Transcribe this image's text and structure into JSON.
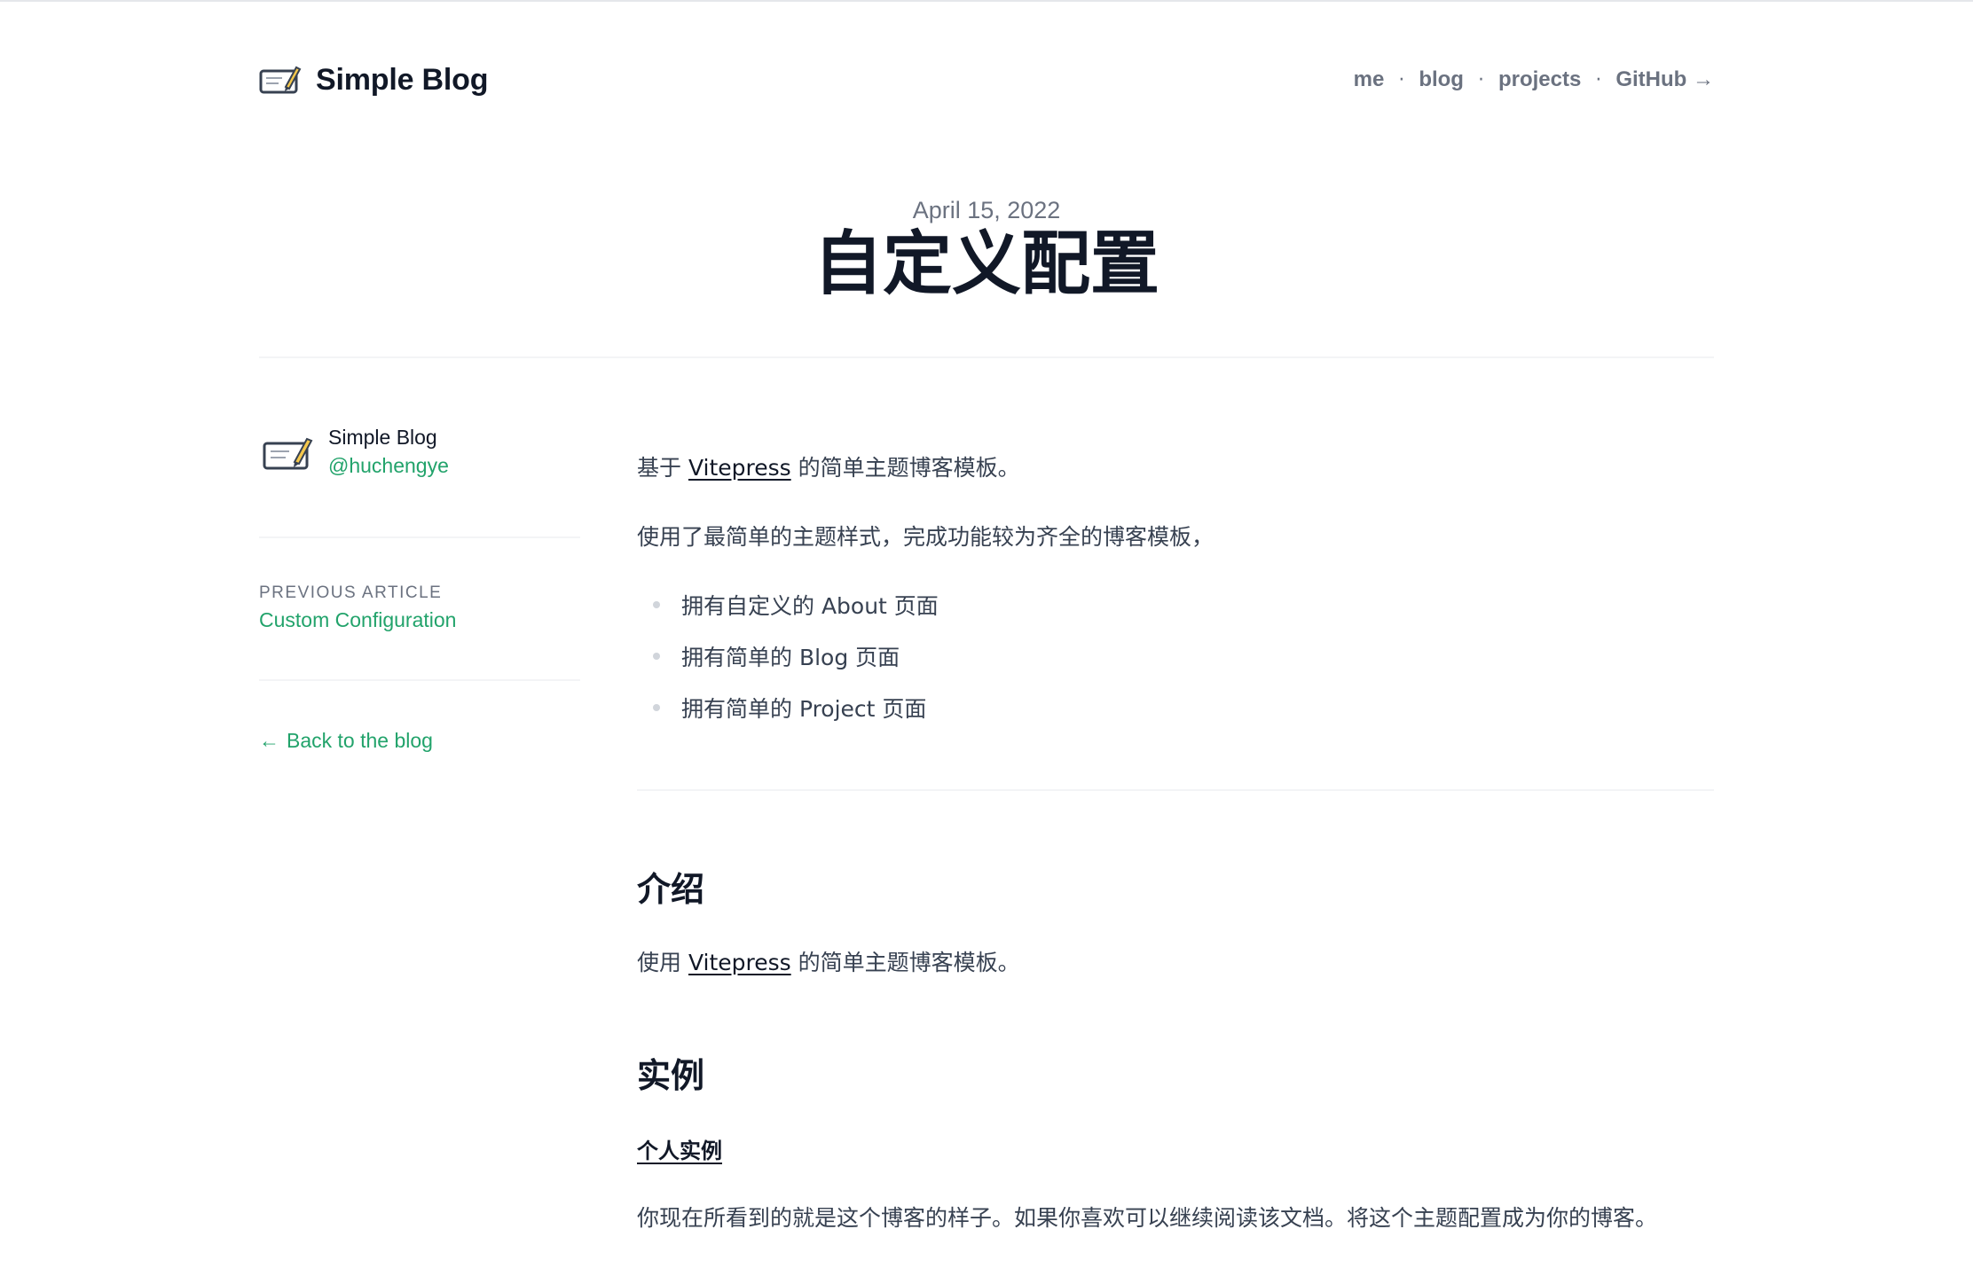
{
  "header": {
    "brand": "Simple Blog",
    "nav": [
      {
        "label": "me"
      },
      {
        "label": "blog"
      },
      {
        "label": "projects"
      },
      {
        "label": "GitHub →"
      }
    ],
    "separator": "·"
  },
  "post": {
    "date": "April 15, 2022",
    "title": "自定义配置"
  },
  "sidebar": {
    "author_name": "Simple Blog",
    "author_handle": "@huchengye",
    "prev_label": "PREVIOUS ARTICLE",
    "prev_title": "Custom Configuration",
    "back_arrow": "←",
    "back_label": "Back to the blog"
  },
  "content": {
    "intro_prefix": "基于 ",
    "intro_link": "Vitepress",
    "intro_suffix": " 的简单主题博客模板。",
    "desc": "使用了最简单的主题样式，完成功能较为齐全的博客模板，",
    "features": [
      "拥有自定义的 About 页面",
      "拥有简单的 Blog 页面",
      "拥有简单的 Project 页面"
    ],
    "section1_heading": "介绍",
    "section1_prefix": "使用 ",
    "section1_link": "Vitepress",
    "section1_suffix": " 的简单主题博客模板。",
    "section2_heading": "实例",
    "section2_subheading": "个人实例",
    "section2_text": "你现在所看到的就是这个博客的样子。如果你喜欢可以继续阅读该文档。将这个主题配置成为你的博客。"
  },
  "colors": {
    "accent": "#22a36b",
    "heading": "#111827",
    "body": "#374151",
    "muted": "#6b7280"
  },
  "icons": {
    "brand": "pencil-card-icon",
    "author": "pencil-card-icon"
  }
}
